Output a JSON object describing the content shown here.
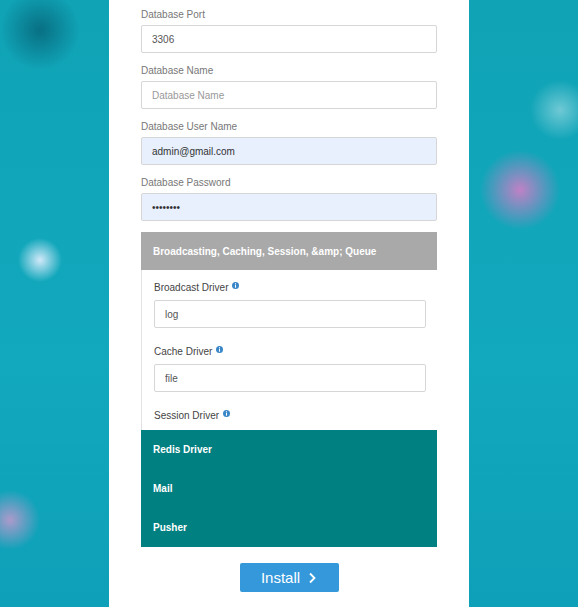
{
  "fields": [
    {
      "label": "Database Port",
      "value": "3306",
      "placeholder": "",
      "autofilled": false
    },
    {
      "label": "Database Name",
      "value": "",
      "placeholder": "Database Name",
      "autofilled": false
    },
    {
      "label": "Database User Name",
      "value": "admin@gmail.com",
      "placeholder": "",
      "autofilled": true
    },
    {
      "label": "Database Password",
      "value": "••••••••",
      "placeholder": "",
      "autofilled": true
    }
  ],
  "accordion": {
    "title": "Broadcasting, Caching, Session, &amp; Queue",
    "expanded": true,
    "fields": [
      {
        "label": "Broadcast Driver",
        "value": "log",
        "has_input": true
      },
      {
        "label": "Cache Driver",
        "value": "file",
        "has_input": true
      },
      {
        "label": "Session Driver",
        "value": "",
        "has_input": false
      }
    ]
  },
  "sections": [
    {
      "title": "Redis Driver",
      "expanded": false
    },
    {
      "title": "Mail",
      "expanded": false
    },
    {
      "title": "Pusher",
      "expanded": false
    }
  ],
  "button": {
    "label": "Install"
  }
}
